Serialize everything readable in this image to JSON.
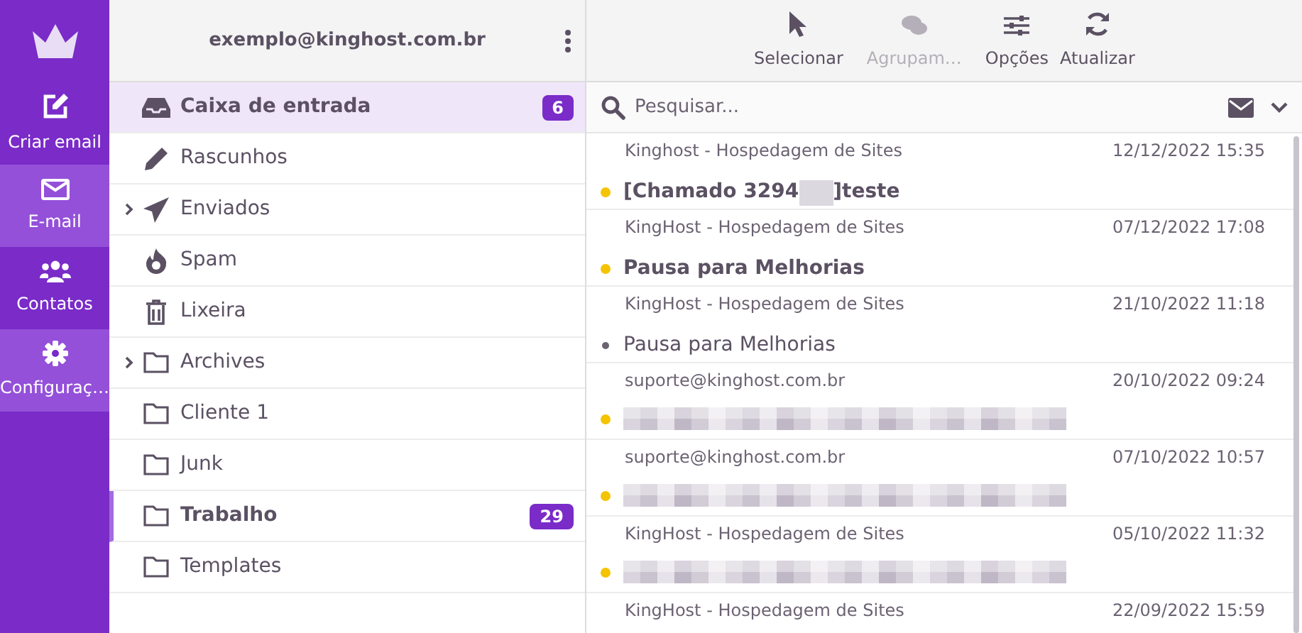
{
  "nav": [
    {
      "label": "Criar email",
      "highlighted": false
    },
    {
      "label": "E-mail",
      "highlighted": true
    },
    {
      "label": "Contatos",
      "highlighted": false
    },
    {
      "label": "Configuraç…",
      "highlighted": true
    }
  ],
  "account": {
    "email": "exemplo@kinghost.com.br"
  },
  "folders": [
    {
      "name": "Caixa de entrada",
      "kind": "inbox",
      "expandable": false,
      "unread": true,
      "count": "6",
      "selected": true,
      "focused": false
    },
    {
      "name": "Rascunhos",
      "kind": "drafts",
      "expandable": false,
      "unread": false,
      "selected": false,
      "focused": false
    },
    {
      "name": "Enviados",
      "kind": "sent",
      "expandable": true,
      "unread": false,
      "selected": false,
      "focused": false
    },
    {
      "name": "Spam",
      "kind": "spam",
      "expandable": false,
      "unread": false,
      "selected": false,
      "focused": false
    },
    {
      "name": "Lixeira",
      "kind": "trash",
      "expandable": false,
      "unread": false,
      "selected": false,
      "focused": false
    },
    {
      "name": "Archives",
      "kind": "folder",
      "expandable": true,
      "unread": false,
      "selected": false,
      "focused": false
    },
    {
      "name": "Cliente 1",
      "kind": "folder",
      "expandable": false,
      "unread": false,
      "selected": false,
      "focused": false
    },
    {
      "name": "Junk",
      "kind": "folder",
      "expandable": false,
      "unread": false,
      "selected": false,
      "focused": false
    },
    {
      "name": "Trabalho",
      "kind": "folder",
      "expandable": false,
      "unread": true,
      "count": "29",
      "selected": false,
      "focused": true
    },
    {
      "name": "Templates",
      "kind": "folder",
      "expandable": false,
      "unread": false,
      "selected": false,
      "focused": false
    }
  ],
  "toolbar": [
    {
      "label": "Selecionar",
      "disabled": false
    },
    {
      "label": "Agrupam…",
      "disabled": true
    },
    {
      "label": "Opções",
      "disabled": false
    },
    {
      "label": "Atualizar",
      "disabled": false
    }
  ],
  "search": {
    "placeholder": "Pesquisar..."
  },
  "messages": [
    {
      "sender": "Kinghost - Hospedagem de Sites",
      "date": "12/12/2022 15:35",
      "subject": "[Chamado 3294",
      "subject_end": "]teste",
      "redacted": true,
      "unread": true
    },
    {
      "sender": "KingHost - Hospedagem de Sites",
      "date": "07/12/2022 17:08",
      "subject": "Pausa para Melhorias",
      "redacted": false,
      "unread": true
    },
    {
      "sender": "KingHost - Hospedagem de Sites",
      "date": "21/10/2022 11:18",
      "subject": "Pausa para Melhorias",
      "redacted": false,
      "unread": false
    },
    {
      "sender": "suporte@kinghost.com.br",
      "date": "20/10/2022 09:24",
      "redacted": true,
      "unread": true
    },
    {
      "sender": "suporte@kinghost.com.br",
      "date": "07/10/2022 10:57",
      "redacted": true,
      "unread": true
    },
    {
      "sender": "KingHost - Hospedagem de Sites",
      "date": "05/10/2022 11:32",
      "redacted": true,
      "unread": true
    },
    {
      "sender": "KingHost - Hospedagem de Sites",
      "date": "22/09/2022 15:59"
    }
  ]
}
